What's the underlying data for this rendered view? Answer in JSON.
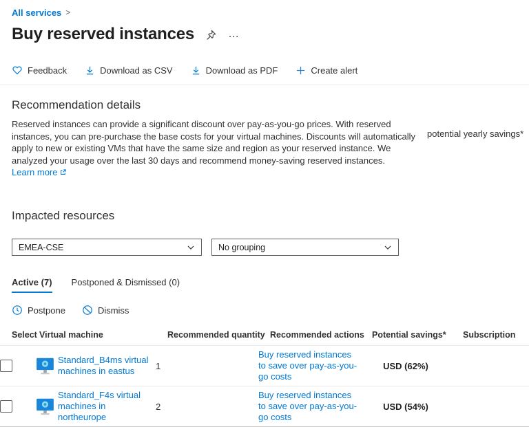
{
  "colors": {
    "accent": "#0078d4",
    "text": "#323130",
    "muted": "#605e5c",
    "divider": "#edebe9"
  },
  "breadcrumb": {
    "all_services": "All services",
    "separator": ">"
  },
  "header": {
    "title": "Buy reserved instances",
    "more_label": "…"
  },
  "toolbar": {
    "items": [
      {
        "icon": "heart-icon",
        "label": "Feedback"
      },
      {
        "icon": "download-icon",
        "label": "Download as CSV"
      },
      {
        "icon": "download-icon",
        "label": "Download as PDF"
      },
      {
        "icon": "plus-icon",
        "label": "Create alert"
      }
    ]
  },
  "recommendation": {
    "heading": "Recommendation details",
    "body": "Reserved instances can provide a significant discount over pay-as-you-go prices. With reserved instances, you can pre-purchase the base costs for your virtual machines. Discounts will automatically apply to new or existing VMs that have the same size and region as your reserved instance. We analyzed your usage over the last 30 days and recommend money-saving reserved instances.",
    "learn_more": "Learn more",
    "side_label": "potential yearly savings*"
  },
  "impacted": {
    "heading": "Impacted resources",
    "scope_filter": "EMEA-CSE",
    "grouping_filter": "No grouping"
  },
  "tabs": [
    {
      "label": "Active (7)",
      "active": true
    },
    {
      "label": "Postponed & Dismissed (0)",
      "active": false
    }
  ],
  "commands": [
    {
      "icon": "clock-icon",
      "label": "Postpone"
    },
    {
      "icon": "blocked-icon",
      "label": "Dismiss"
    }
  ],
  "table": {
    "columns": [
      "Select",
      "Virtual machine",
      "Recommended quantity",
      "Recommended actions",
      "Potential savings*",
      "Subscription"
    ],
    "rows": [
      {
        "vm": "Standard_B4ms virtual machines in eastus",
        "quantity": "1",
        "action": "Buy reserved instances to save over pay-as-you-go costs",
        "savings": "USD (62%)",
        "subscription": ""
      },
      {
        "vm": "Standard_F4s virtual machines in northeurope",
        "quantity": "2",
        "action": "Buy reserved instances to save over pay-as-you-go costs",
        "savings": "USD (54%)",
        "subscription": ""
      }
    ]
  }
}
